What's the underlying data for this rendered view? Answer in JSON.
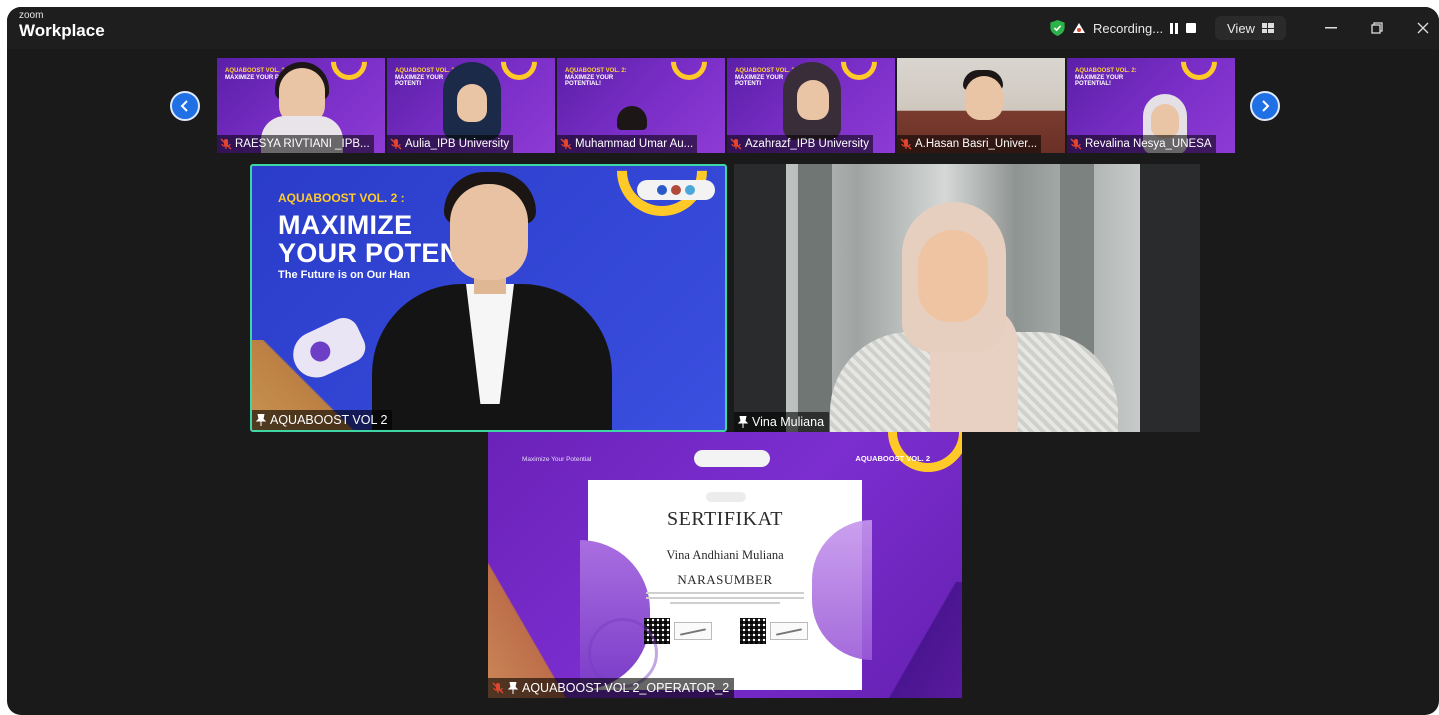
{
  "titlebar": {
    "brand_small": "zoom",
    "brand_big": "Workplace",
    "recording_label": "Recording...",
    "view_label": "View",
    "icons": [
      "shield-check-icon",
      "cloud-icon",
      "pause-icon",
      "stop-icon",
      "grid-view-icon",
      "minimize-icon",
      "restore-icon",
      "close-icon"
    ]
  },
  "gallery": {
    "prev_icon": "chevron-left-icon",
    "next_icon": "chevron-right-icon",
    "thumbnails": [
      {
        "name": "RAESYA RIVTIANI _IPB...",
        "headline_sub": "AQUABOOST VOL. 2:",
        "headline": "MAXIMIZE YOUR POTE"
      },
      {
        "name": "Aulia_IPB University",
        "headline_sub": "AQUABOOST VOL. 2:",
        "headline": "MAXIMIZE YOUR POTENTI"
      },
      {
        "name": "Muhammad Umar Au...",
        "headline_sub": "AQUABOOST VOL. 2:",
        "headline": "MAXIMIZE YOUR POTENTIAL!"
      },
      {
        "name": "Azahrazf_IPB University",
        "headline_sub": "AQUABOOST VOL. 2:",
        "headline": "MAXIMIZE YOUR POTENTI"
      },
      {
        "name": "A.Hasan Basri_Univer..."
      },
      {
        "name": "Revalina Nesya_UNESA",
        "headline_sub": "AQUABOOST VOL. 2:",
        "headline": "MAXIMIZE YOUR POTENTIAL!"
      }
    ]
  },
  "main_left": {
    "headline_sub": "AQUABOOST VOL. 2 :",
    "headline_1": "MAXIMIZE",
    "headline_2": "YOUR POTENT",
    "tagline": "The Future is on Our Han",
    "label": "AQUABOOST VOL 2"
  },
  "main_right": {
    "label": "Vina Muliana"
  },
  "main_bottom": {
    "top_left": "Maximize Your Potential",
    "top_right": "AQUABOOST VOL. 2",
    "certificate": {
      "title": "SERTIFIKAT",
      "name": "Vina Andhiani Muliana",
      "role": "NARASUMBER"
    },
    "label": "AQUABOOST VOL 2_OPERATOR_2"
  },
  "colors": {
    "active_speaker_border": "#3fd6a6",
    "nav_button": "#1f6fe5",
    "banner_purple": "#7b2fc8",
    "accent_yellow": "#ffc928",
    "muted_mic": "#e2452f"
  }
}
